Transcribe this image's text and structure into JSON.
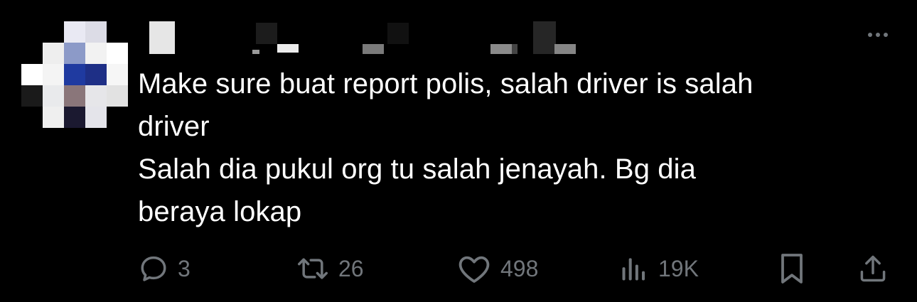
{
  "tweet": {
    "lines": [
      "Make sure buat report polis, salah driver is salah",
      "driver",
      "Salah dia pukul org tu salah jenayah. Bg dia",
      "beraya lokap"
    ]
  },
  "actions": {
    "reply": {
      "icon": "reply-bubble-icon",
      "count": "3"
    },
    "repost": {
      "icon": "repost-icon",
      "count": "26"
    },
    "like": {
      "icon": "heart-icon",
      "count": "498"
    },
    "views": {
      "icon": "views-bar-chart-icon",
      "count": "19K"
    },
    "bookmark": {
      "icon": "bookmark-icon"
    },
    "share": {
      "icon": "share-upload-icon"
    }
  },
  "colors": {
    "background": "#000000",
    "text": "#ffffff",
    "muted": "#71767b"
  }
}
